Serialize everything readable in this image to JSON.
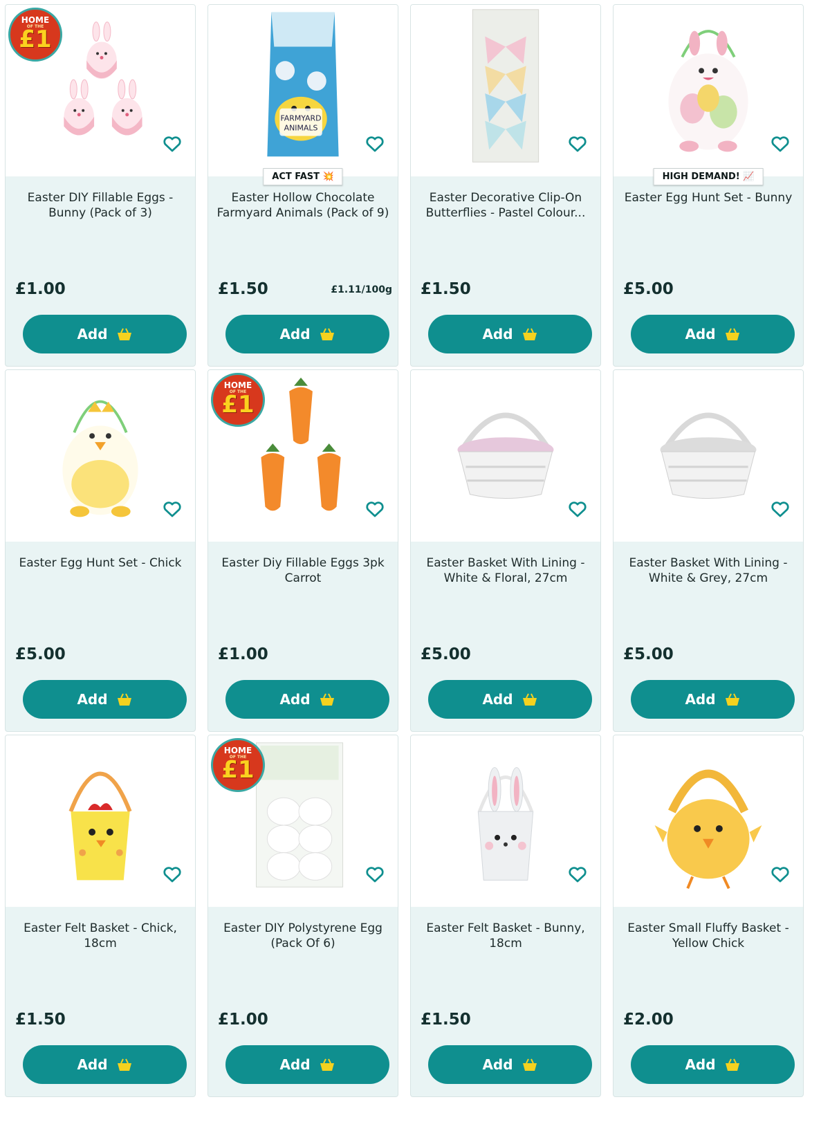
{
  "badge": {
    "line1": "HOME",
    "line2": "OF THE",
    "line3": "£1"
  },
  "add_label": "Add",
  "icons": {
    "wishlist": "heart-icon",
    "cart": "basket-icon"
  },
  "colors": {
    "button": "#0f8f8f",
    "card_bg": "#e9f4f4",
    "basket_icon": "#f5d21f",
    "badge_red": "#d7381d"
  },
  "products": [
    {
      "title": "Easter DIY Fillable Eggs - Bunny (Pack of 3)",
      "price": "£1.00",
      "badge": true,
      "image": "bunny-eggs"
    },
    {
      "title": "Easter Hollow Chocolate Farmyard Animals (Pack of 9)",
      "price": "£1.50",
      "unit_price": "£1.11/100g",
      "tag": "ACT FAST 💥",
      "image": "chocolate-pack"
    },
    {
      "title": "Easter Decorative Clip-On Butterflies - Pastel Colour...",
      "price": "£1.50",
      "image": "butterflies"
    },
    {
      "title": "Easter Egg Hunt Set - Bunny",
      "price": "£5.00",
      "tag": "HIGH DEMAND! 📈",
      "image": "bunny-bucket"
    },
    {
      "title": "Easter Egg Hunt Set - Chick",
      "price": "£5.00",
      "image": "chick-bucket"
    },
    {
      "title": "Easter Diy Fillable Eggs 3pk Carrot",
      "price": "£1.00",
      "badge": true,
      "image": "carrots"
    },
    {
      "title": "Easter Basket With Lining - White & Floral, 27cm",
      "price": "£5.00",
      "image": "basket-floral"
    },
    {
      "title": "Easter Basket With Lining - White & Grey, 27cm",
      "price": "£5.00",
      "image": "basket-grey"
    },
    {
      "title": "Easter Felt Basket - Chick, 18cm",
      "price": "£1.50",
      "image": "felt-chick"
    },
    {
      "title": "Easter DIY Polystyrene Egg (Pack Of 6)",
      "price": "£1.00",
      "badge": true,
      "image": "polystyrene-eggs"
    },
    {
      "title": "Easter Felt Basket - Bunny, 18cm",
      "price": "£1.50",
      "image": "felt-bunny"
    },
    {
      "title": "Easter Small Fluffy Basket - Yellow Chick",
      "price": "£2.00",
      "image": "fluffy-chick"
    }
  ]
}
